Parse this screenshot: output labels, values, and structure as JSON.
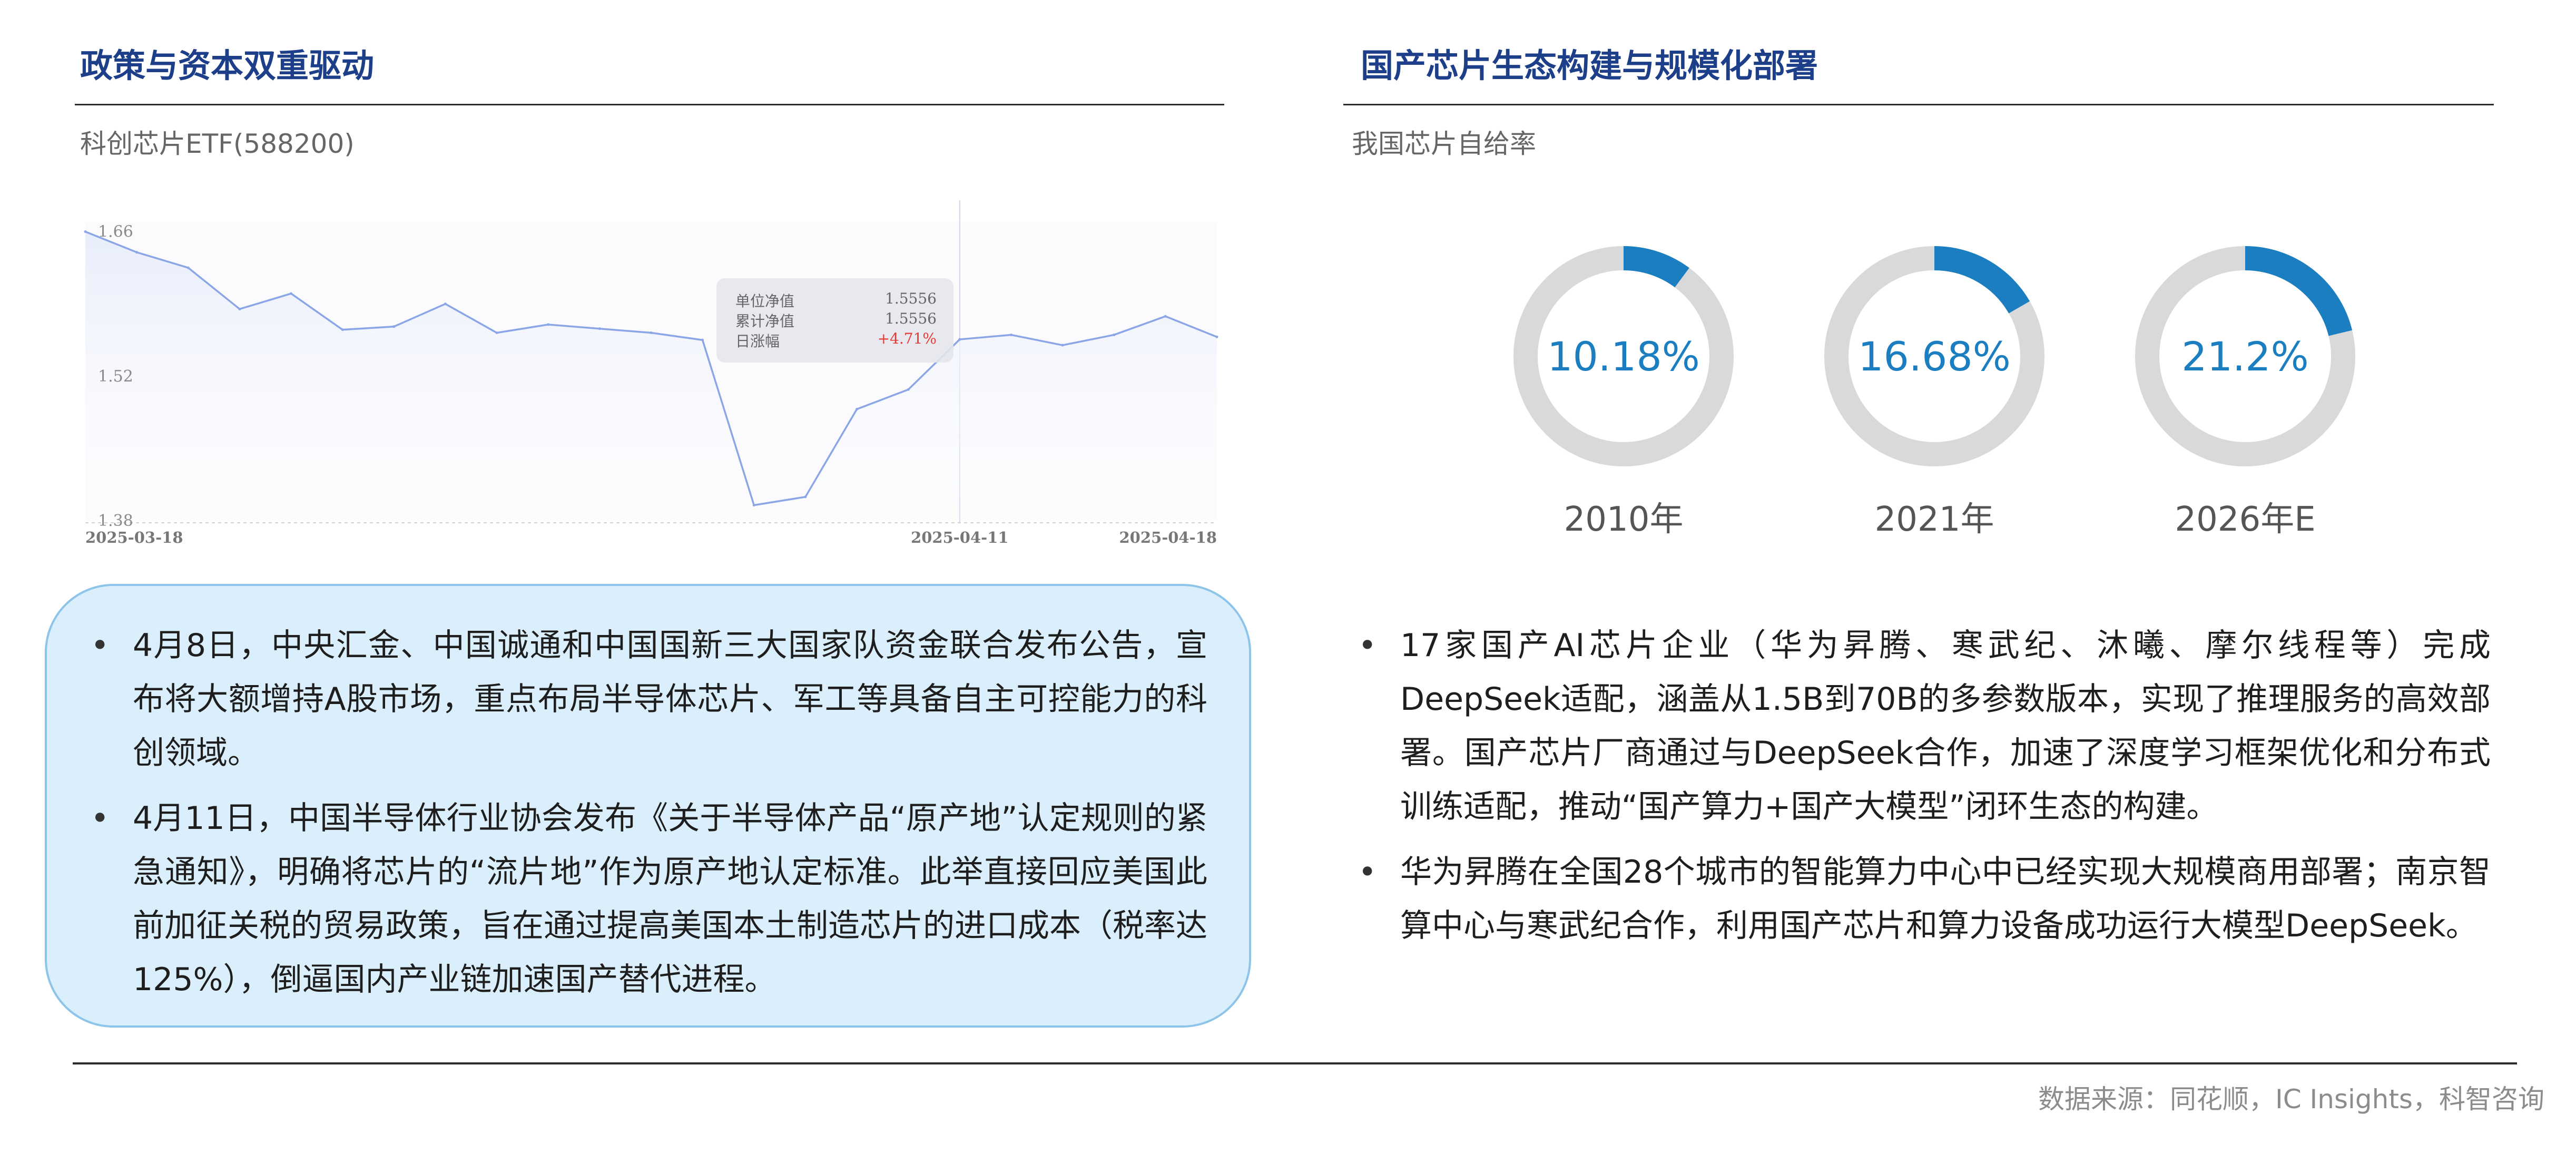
{
  "left_section": {
    "title": "政策与资本双重驱动",
    "chart_subtitle": "科创芯片ETF(588200)",
    "tooltip": [
      {
        "label": "单位净值",
        "value": "1.5556"
      },
      {
        "label": "累计净值",
        "value": "1.5556"
      },
      {
        "label": "日涨幅",
        "value": "+4.71%"
      }
    ],
    "bullets": [
      "4月8日，中央汇金、中国诚通和中国国新三大国家队资金联合发布公告，宣布将大额增持A股市场，重点布局半导体芯片、军工等具备自主可控能力的科创领域。",
      "4月11日，中国半导体行业协会发布《关于半导体产品“原产地”认定规则的紧急通知》，明确将芯片的“流片地”作为原产地认定标准。此举直接回应美国此前加征关税的贸易政策，旨在通过提高美国本土制造芯片的进口成本（税率达125%），倒逼国内产业链加速国产替代进程。"
    ]
  },
  "right_section": {
    "title": "国产芯片生态构建与规模化部署",
    "chart_subtitle": "我国芯片自给率",
    "bullets": [
      "17家国产AI芯片企业（华为昇腾、寒武纪、沐曦、摩尔线程等）完成DeepSeek适配，涵盖从1.5B到70B的多参数版本，实现了推理服务的高效部署。国产芯片厂商通过与DeepSeek合作，加速了深度学习框架优化和分布式训练适配，推动“国产算力+国产大模型”闭环生态的构建。",
      "华为昇腾在全国28个城市的智能算力中心中已经实现大规模商用部署；南京智算中心与寒武纪合作，利用国产芯片和算力设备成功运行大模型DeepSeek。"
    ]
  },
  "source": "数据来源：同花顺，IC Insights，科智咨询",
  "colors": {
    "title": "#1d3f8a",
    "line": "#8aa6e6",
    "area_top": "#e8edfb",
    "donut_fill": "#1a7ec0",
    "donut_track": "#d9d9d9",
    "callout_bg": "#dbeefb",
    "callout_border": "#8cc4ea",
    "positive_change": "#e53935"
  },
  "chart_data": [
    {
      "type": "area",
      "title": "科创芯片ETF(588200)",
      "y_ticks": [
        "1.66",
        "1.52",
        "1.38"
      ],
      "ylim": [
        1.38,
        1.67
      ],
      "x_ticks": [
        "2025-03-18",
        "2025-04-11",
        "2025-04-18"
      ],
      "crosshair_x": "2025-04-11",
      "x": [
        "2025-03-18",
        "2025-03-19",
        "2025-03-20",
        "2025-03-21",
        "2025-03-24",
        "2025-03-25",
        "2025-03-26",
        "2025-03-27",
        "2025-03-28",
        "2025-03-31",
        "2025-04-01",
        "2025-04-02",
        "2025-04-03",
        "2025-04-07",
        "2025-04-08",
        "2025-04-09",
        "2025-04-10",
        "2025-04-11",
        "2025-04-14",
        "2025-04-15",
        "2025-04-16",
        "2025-04-17",
        "2025-04-18"
      ],
      "values": [
        1.66,
        1.64,
        1.625,
        1.585,
        1.6,
        1.565,
        1.568,
        1.59,
        1.562,
        1.57,
        1.566,
        1.562,
        1.555,
        1.395,
        1.403,
        1.488,
        1.507,
        1.5556,
        1.56,
        1.55,
        1.56,
        1.578,
        1.558
      ],
      "grid": false,
      "legend": "none"
    },
    {
      "type": "pie",
      "title": "我国芯片自给率",
      "categories": [
        "2010年",
        "2021年",
        "2026年E"
      ],
      "values": [
        10.18,
        16.68,
        21.2
      ],
      "labels": [
        "10.18%",
        "16.68%",
        "21.2%"
      ],
      "unit": "%"
    }
  ]
}
